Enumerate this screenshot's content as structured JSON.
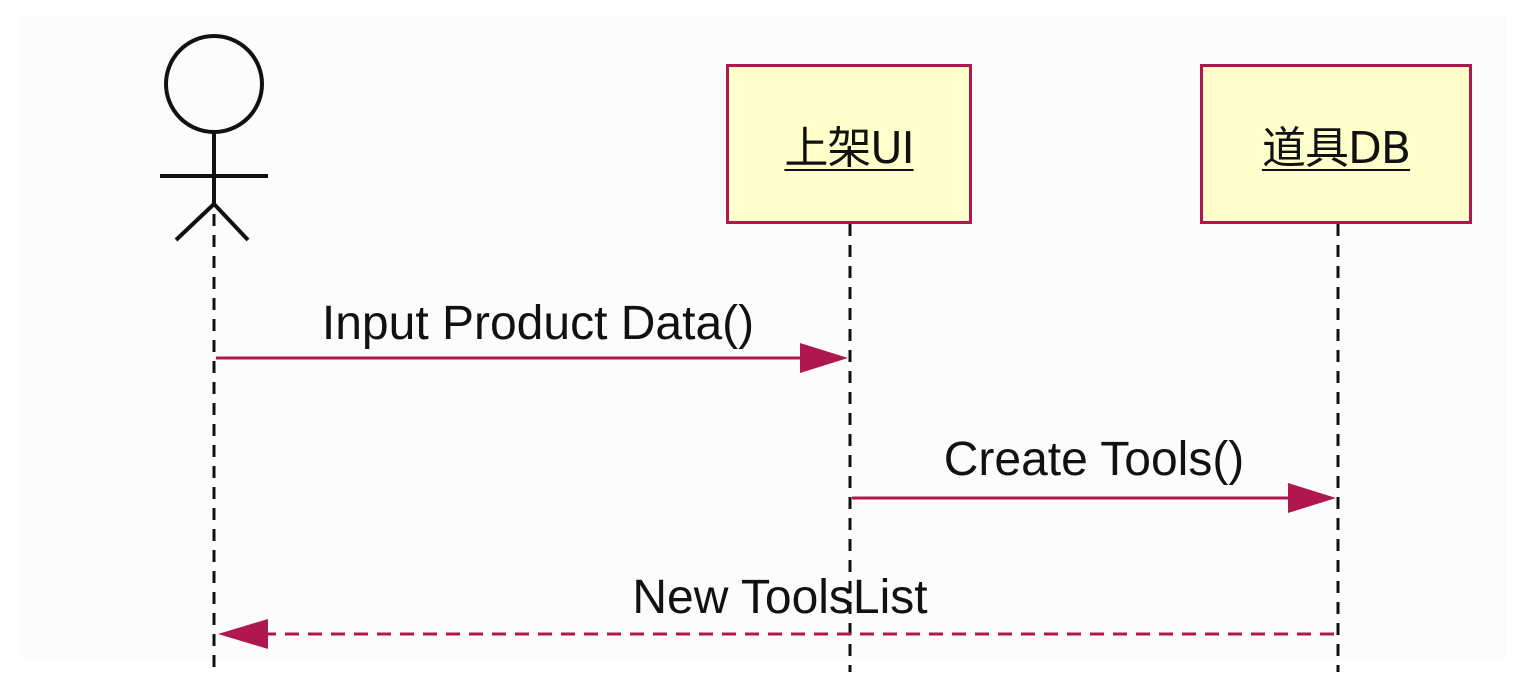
{
  "diagram": {
    "participants": [
      {
        "id": "actor",
        "kind": "actor",
        "label": ""
      },
      {
        "id": "ui",
        "kind": "object",
        "label": "上架UI"
      },
      {
        "id": "db",
        "kind": "object",
        "label": "道具DB"
      }
    ],
    "messages": [
      {
        "from": "actor",
        "to": "ui",
        "label": "Input Product Data()",
        "style": "solid"
      },
      {
        "from": "ui",
        "to": "db",
        "label": "Create Tools()",
        "style": "solid"
      },
      {
        "from": "db",
        "to": "actor",
        "label": "New ToolsList",
        "style": "dashed"
      }
    ],
    "colors": {
      "object_fill": "#ffffcc",
      "accent": "#b0174f",
      "line": "#111111"
    }
  }
}
